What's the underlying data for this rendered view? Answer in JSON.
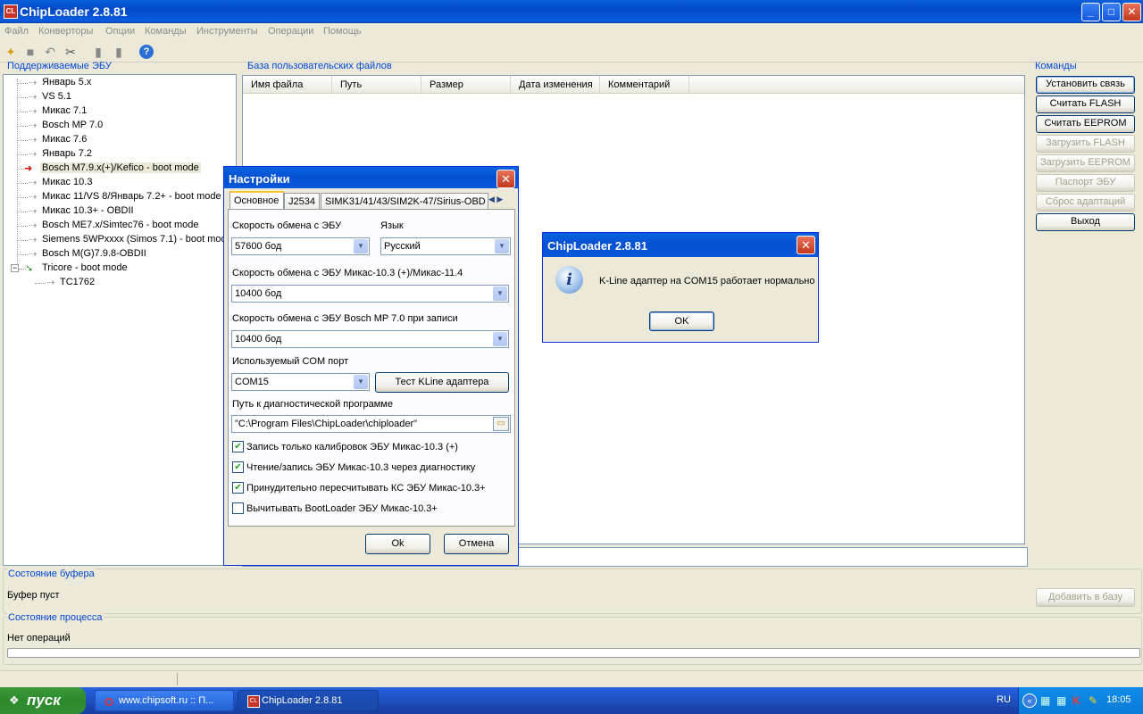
{
  "app": {
    "title": "ChipLoader 2.8.81",
    "icon_label": "CL"
  },
  "menu": [
    "Файл",
    "Конверторы",
    "Опции",
    "Команды",
    "Инструменты",
    "Операции",
    "Помощь"
  ],
  "panels": {
    "ecu_title": "Поддерживаемые ЭБУ",
    "files_title": "База пользовательских файлов",
    "commands_title": "Команды",
    "buffer_title": "Состояние буфера",
    "buffer_status": "Буфер пуст",
    "process_title": "Состояние процесса",
    "process_status": "Нет операций",
    "progress": 0
  },
  "ecu_tree": [
    "Январь 5.х",
    "VS 5.1",
    "Микас 7.1",
    "Bosch MP 7.0",
    "Микас 7.6",
    "Январь 7.2",
    "Bosch M7.9.x(+)/Kefico - boot mode",
    "Микас 10.3",
    "Микас 11/VS 8/Январь 7.2+ - boot mode",
    "Микас 10.3+ - OBDII",
    "Bosch ME7.x/Simtec76 - boot mode",
    "Siemens 5WPxxxx (Simos 7.1) - boot mode",
    "Bosch M(G)7.9.8-OBDII",
    "Tricore - boot mode",
    "TC1762"
  ],
  "file_columns": [
    "Имя файла",
    "Путь",
    "Размер",
    "Дата изменения",
    "Комментарий"
  ],
  "commands": [
    "Установить связь",
    "Считать FLASH",
    "Считать EEPROM",
    "Загрузить FLASH",
    "Загрузить EEPROM",
    "Паспорт ЭБУ",
    "Сброс адаптаций",
    "Выход"
  ],
  "add_to_db": "Добавить в базу",
  "settings": {
    "title": "Настройки",
    "tabs": [
      "Основное",
      "J2534",
      "SIMK31/41/43/SIM2K-47/Sirius-OBD"
    ],
    "ecu_speed_label": "Скорость обмена с ЭБУ",
    "ecu_speed_value": "57600 бод",
    "lang_label": "Язык",
    "lang_value": "Русский",
    "mikas_speed_label": "Скорость обмена с ЭБУ Микас-10.3 (+)/Микас-11.4",
    "mikas_speed_value": "10400 бод",
    "bosch_speed_label": "Скорость обмена с ЭБУ Bosch MP 7.0 при записи",
    "bosch_speed_value": "10400 бод",
    "com_label": "Используемый COM порт",
    "com_value": "COM15",
    "test_btn": "Тест KLine адаптера",
    "path_label": "Путь к диагностической программе",
    "path_value": "\"C:\\Program Files\\ChipLoader\\chiploader\"",
    "checks": [
      {
        "label": "Запись только калибровок ЭБУ Микас-10.3 (+)",
        "checked": true
      },
      {
        "label": "Чтение/запись ЭБУ Микас-10.3 через диагностику",
        "checked": true
      },
      {
        "label": "Принудительно пересчитывать КС ЭБУ Микас-10.3+",
        "checked": true
      },
      {
        "label": "Вычитывать BootLoader ЭБУ Микас-10.3+",
        "checked": false
      }
    ],
    "ok": "Ok",
    "cancel": "Отмена"
  },
  "msgbox": {
    "title": "ChipLoader 2.8.81",
    "text": "K-Line адаптер на COM15 работает нормально",
    "ok": "OK"
  },
  "taskbar": {
    "start": "пуск",
    "tasks": [
      "www.chipsoft.ru :: П...",
      "ChipLoader 2.8.81"
    ],
    "lang": "RU",
    "clock": "18:05"
  }
}
